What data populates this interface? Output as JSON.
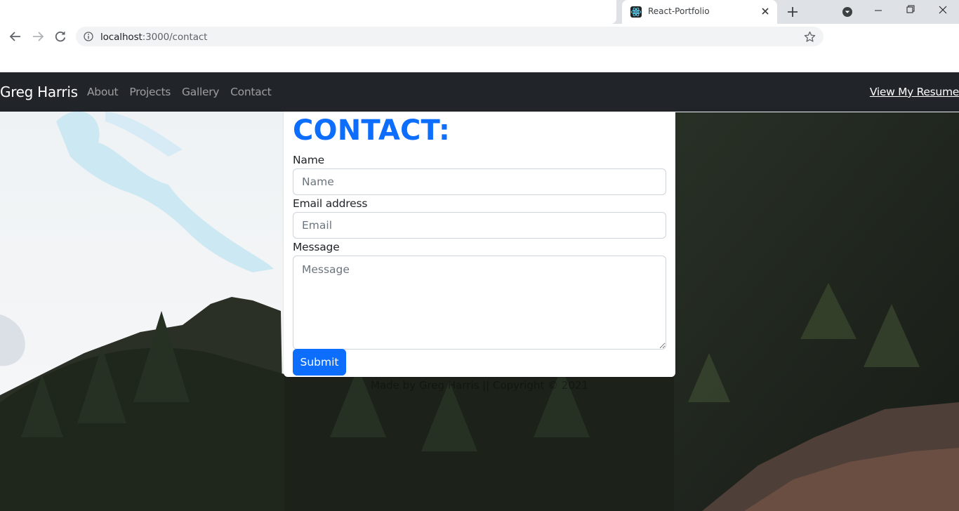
{
  "browser": {
    "tab_title": "React-Portfolio",
    "url_host": "localhost",
    "url_rest": ":3000/contact",
    "icons": {
      "favicon": "react-icon",
      "tab_close": "close-icon",
      "new_tab": "plus-icon",
      "tab_search": "chevron-down-icon",
      "back": "arrow-left-icon",
      "forward": "arrow-right-icon",
      "reload": "reload-icon",
      "site_info": "info-icon",
      "bookmark": "star-icon"
    }
  },
  "navbar": {
    "brand": "Greg Harris",
    "links": [
      "About",
      "Projects",
      "Gallery",
      "Contact"
    ],
    "resume_link": "View My Resume"
  },
  "contact_form": {
    "title": "CONTACT:",
    "name_label": "Name",
    "name_placeholder": "Name",
    "email_label": "Email address",
    "email_placeholder": "Email",
    "message_label": "Message",
    "message_placeholder": "Message",
    "submit_label": "Submit"
  },
  "footer": {
    "text": "Made by Greg Harris || Copyright © 2021"
  },
  "colors": {
    "navbar_bg": "#212529",
    "accent": "#0d6efd"
  }
}
